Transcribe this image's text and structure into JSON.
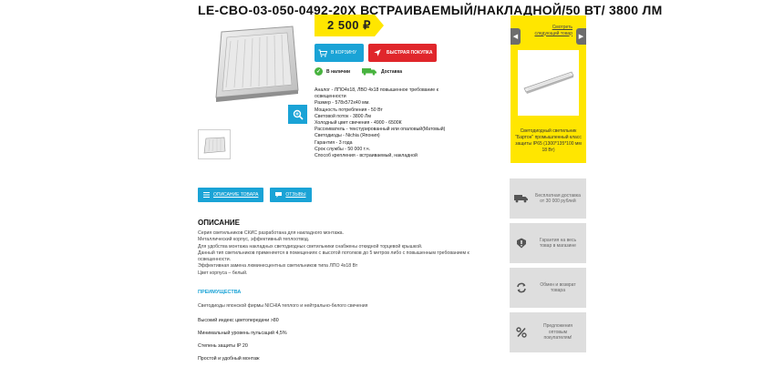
{
  "product": {
    "title": "LE-CBO-03-050-0492-20Х ВСТРАИВАЕМЫЙ/НАКЛАДНОЙ/50 ВТ/ 3800 ЛМ",
    "price": "2 500 ₽"
  },
  "buttons": {
    "cart": "В КОРЗИНУ",
    "buy": "БЫСТРАЯ ПОКУПКА"
  },
  "status": {
    "in_stock": "В наличии",
    "delivery": "Доставка"
  },
  "specs": [
    "Аналог - ЛПО4х18, ЛВО 4х18 повышенное требование к освещенности",
    "Размер - 578х572х40 мм.",
    "Мощность потребления - 50 Вт",
    "Световой поток - 3800 Лм",
    "Холодный цвет свечения - 4900 - 6500К",
    "Рассеиватель - текстурированный или опаловый(Матовый)",
    "Светодиоды - Nichia (Япония)",
    "Гарантия - 3 года",
    "Срок службы - 50 000 т.ч.",
    "Способ крепления - встраиваемый, накладной"
  ],
  "next_product": {
    "link": "Смотреть следующий товар",
    "name": "Светодиодный светильник \"Бартон\" промышленный класс защиты IP65 (1300*135*100 мм 18 Вт)"
  },
  "tabs": {
    "description": "ОПИСАНИЕ ТОВАРА",
    "reviews": "ОТЗЫВЫ"
  },
  "description": {
    "heading": "ОПИСАНИЕ",
    "lines": [
      "Серия светильников СКИС разработана для накладного монтажа.",
      "Металлический корпус, эффективный теплоотвод.",
      "Для удобства монтажа накладных светодиодных светильники снабжены откидной торцевой крышкой.",
      "Данный тип светильников применяется в помещениях с высотой потолков до 5 метров либо с повышенным требованием к освещенности.",
      "Эффективная замена люминесцентных светильников типа ЛПО 4х18 Вт",
      "Цвет корпуса – белый."
    ]
  },
  "advantages": {
    "heading": "ПРЕИМУЩЕСТВА",
    "intro": "Светодиоды японской фирмы NICHIA теплого и нейтрально-белого свечения",
    "items": [
      "Высокий индекс цветопередачи >80",
      "Минимальный уровень пульсаций 4,5%",
      "Степень защиты IP 20",
      "Простой и удобный монтаж"
    ]
  },
  "side": [
    {
      "icon": "truck-icon",
      "text": "Бесплатная доставка от 30 000 рублей"
    },
    {
      "icon": "warranty-icon",
      "text": "Гарантия на весь товар в магазине"
    },
    {
      "icon": "exchange-icon",
      "text": "Обмен и возврат товара"
    },
    {
      "icon": "percent-icon",
      "text": "Предложения оптовым покупателям!"
    }
  ],
  "colors": {
    "accent_blue": "#1aa3d6",
    "buy_red": "#e0262b",
    "price_yellow": "#ffe600",
    "stock_green": "#48b33f",
    "side_gray": "#dedede"
  }
}
